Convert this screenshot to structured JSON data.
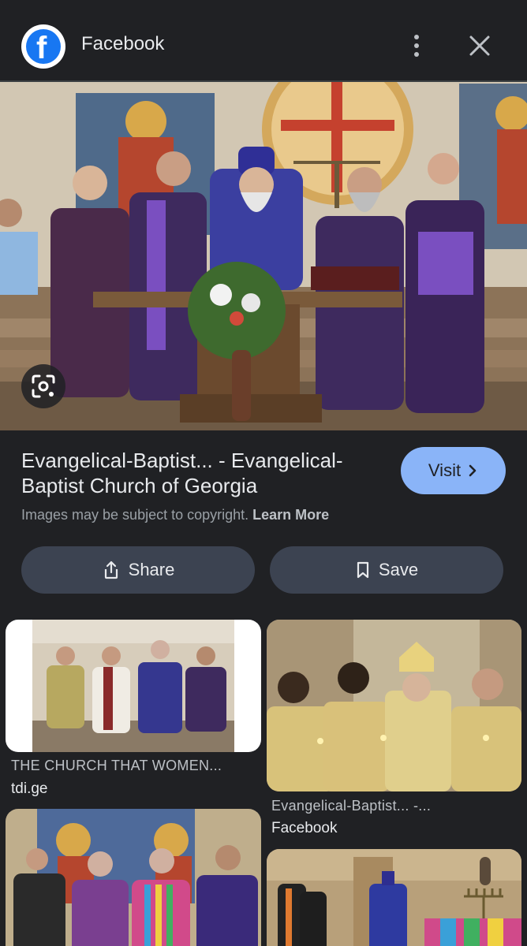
{
  "header": {
    "title": "Facebook",
    "logo_letter": "f"
  },
  "result": {
    "title": "Evangelical-Baptist... - Evangelical-Baptist Church of Georgia",
    "visit_label": "Visit",
    "copyright_text": "Images may be subject to copyright.",
    "learn_more": "Learn More"
  },
  "actions": {
    "share_label": "Share",
    "save_label": "Save"
  },
  "related": [
    {
      "title": "THE CHURCH THAT WOMEN...",
      "source": "tdi.ge"
    },
    {
      "title": "Evangelical-Baptist... -...",
      "source": "Facebook"
    }
  ],
  "colors": {
    "background": "#202124",
    "accent": "#8ab4f8",
    "button_bg": "#3c4351"
  }
}
